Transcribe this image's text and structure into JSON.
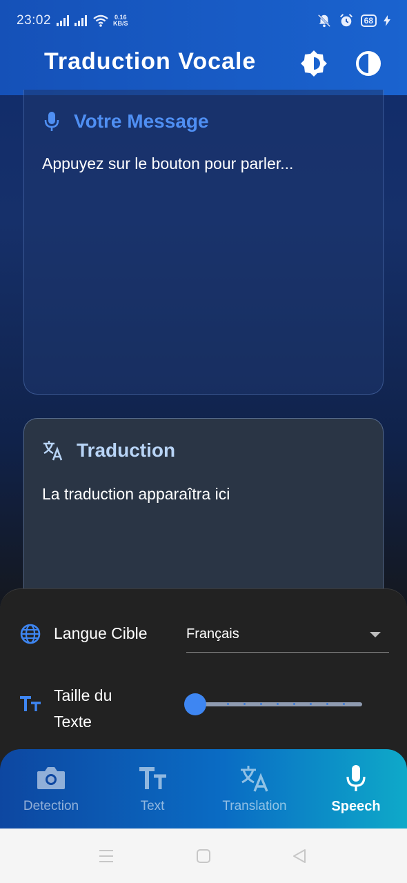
{
  "status": {
    "time": "23:02",
    "net_speed_value": "0.16",
    "net_speed_unit": "KB/S",
    "battery": "68"
  },
  "appbar": {
    "title": "Traduction Vocale",
    "icons": [
      "brightness-icon",
      "contrast-icon"
    ]
  },
  "message_card": {
    "title": "Votre Message",
    "icon": "microphone-icon",
    "placeholder": "Appuyez sur le bouton pour parler..."
  },
  "translation_card": {
    "title": "Traduction",
    "icon": "translate-icon",
    "placeholder": "La traduction apparaîtra ici"
  },
  "settings": {
    "language_label": "Langue Cible",
    "language_value": "Français",
    "text_size_label_line1": "Taille du",
    "text_size_label_line2": "Texte",
    "text_size_level": 0
  },
  "bottom_nav": {
    "items": [
      {
        "label": "Detection",
        "icon": "camera-icon",
        "active": false
      },
      {
        "label": "Text",
        "icon": "text-size-icon",
        "active": false
      },
      {
        "label": "Translation",
        "icon": "translate-icon",
        "active": false
      },
      {
        "label": "Speech",
        "icon": "microphone-icon",
        "active": true
      }
    ]
  },
  "colors": {
    "accent": "#3e86f2",
    "appbar": "#1a63cf",
    "sheet": "#222222"
  }
}
